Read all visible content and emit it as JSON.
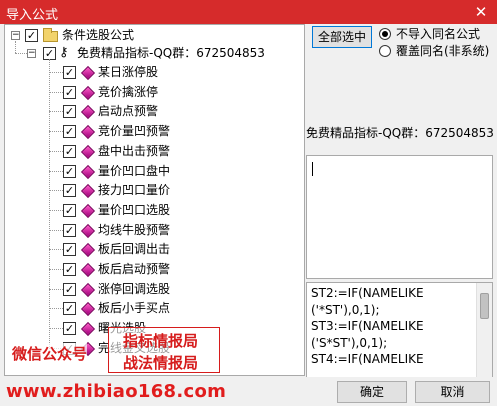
{
  "window": {
    "title": "导入公式",
    "close_glyph": "✕"
  },
  "tree": {
    "root": {
      "label": "条件选股公式",
      "checked": true,
      "expander": "−"
    },
    "group": {
      "label": "免费精品指标-QQ群：672504853",
      "checked": true,
      "expander": "−"
    },
    "items": [
      {
        "label": "某日涨停股",
        "checked": true
      },
      {
        "label": "竞价擒涨停",
        "checked": true
      },
      {
        "label": "启动点预警",
        "checked": true
      },
      {
        "label": "竞价量凹预警",
        "checked": true
      },
      {
        "label": "盘中出击预警",
        "checked": true
      },
      {
        "label": "量价凹口盘中",
        "checked": true
      },
      {
        "label": "接力凹口量价",
        "checked": true
      },
      {
        "label": "量价凹口选股",
        "checked": true
      },
      {
        "label": "均线牛股预警",
        "checked": true
      },
      {
        "label": "板后回调出击",
        "checked": true
      },
      {
        "label": "板后启动预警",
        "checked": true
      },
      {
        "label": "涨停回调选股",
        "checked": true
      },
      {
        "label": "板后小手买点",
        "checked": true
      },
      {
        "label": "曙光选股",
        "checked": true
      },
      {
        "label": "完线金叉选股",
        "checked": true
      }
    ]
  },
  "buttons": {
    "select_all": "全部选中",
    "ok": "确定",
    "cancel": "取消"
  },
  "options": [
    {
      "label": "不导入同名公式",
      "selected": true
    },
    {
      "label": "覆盖同名(非系统)",
      "selected": false
    }
  ],
  "info_label": "免费精品指标-QQ群：672504853",
  "name_field": {
    "value": ""
  },
  "code_text": "ST2:=IF(NAMELIKE\n('*ST'),0,1);\nST3:=IF(NAMELIKE\n('S*ST'),0,1);\nST4:=IF(NAMELIKE",
  "watermarks": {
    "wechat": "微信公众号",
    "line1": "指标情报局",
    "line2": "战法情报局",
    "url": "www.zhibiao168.com"
  },
  "check_glyph": "✓",
  "colors": {
    "titlebar": "#d62b2b",
    "watermark": "#e11d1d"
  }
}
